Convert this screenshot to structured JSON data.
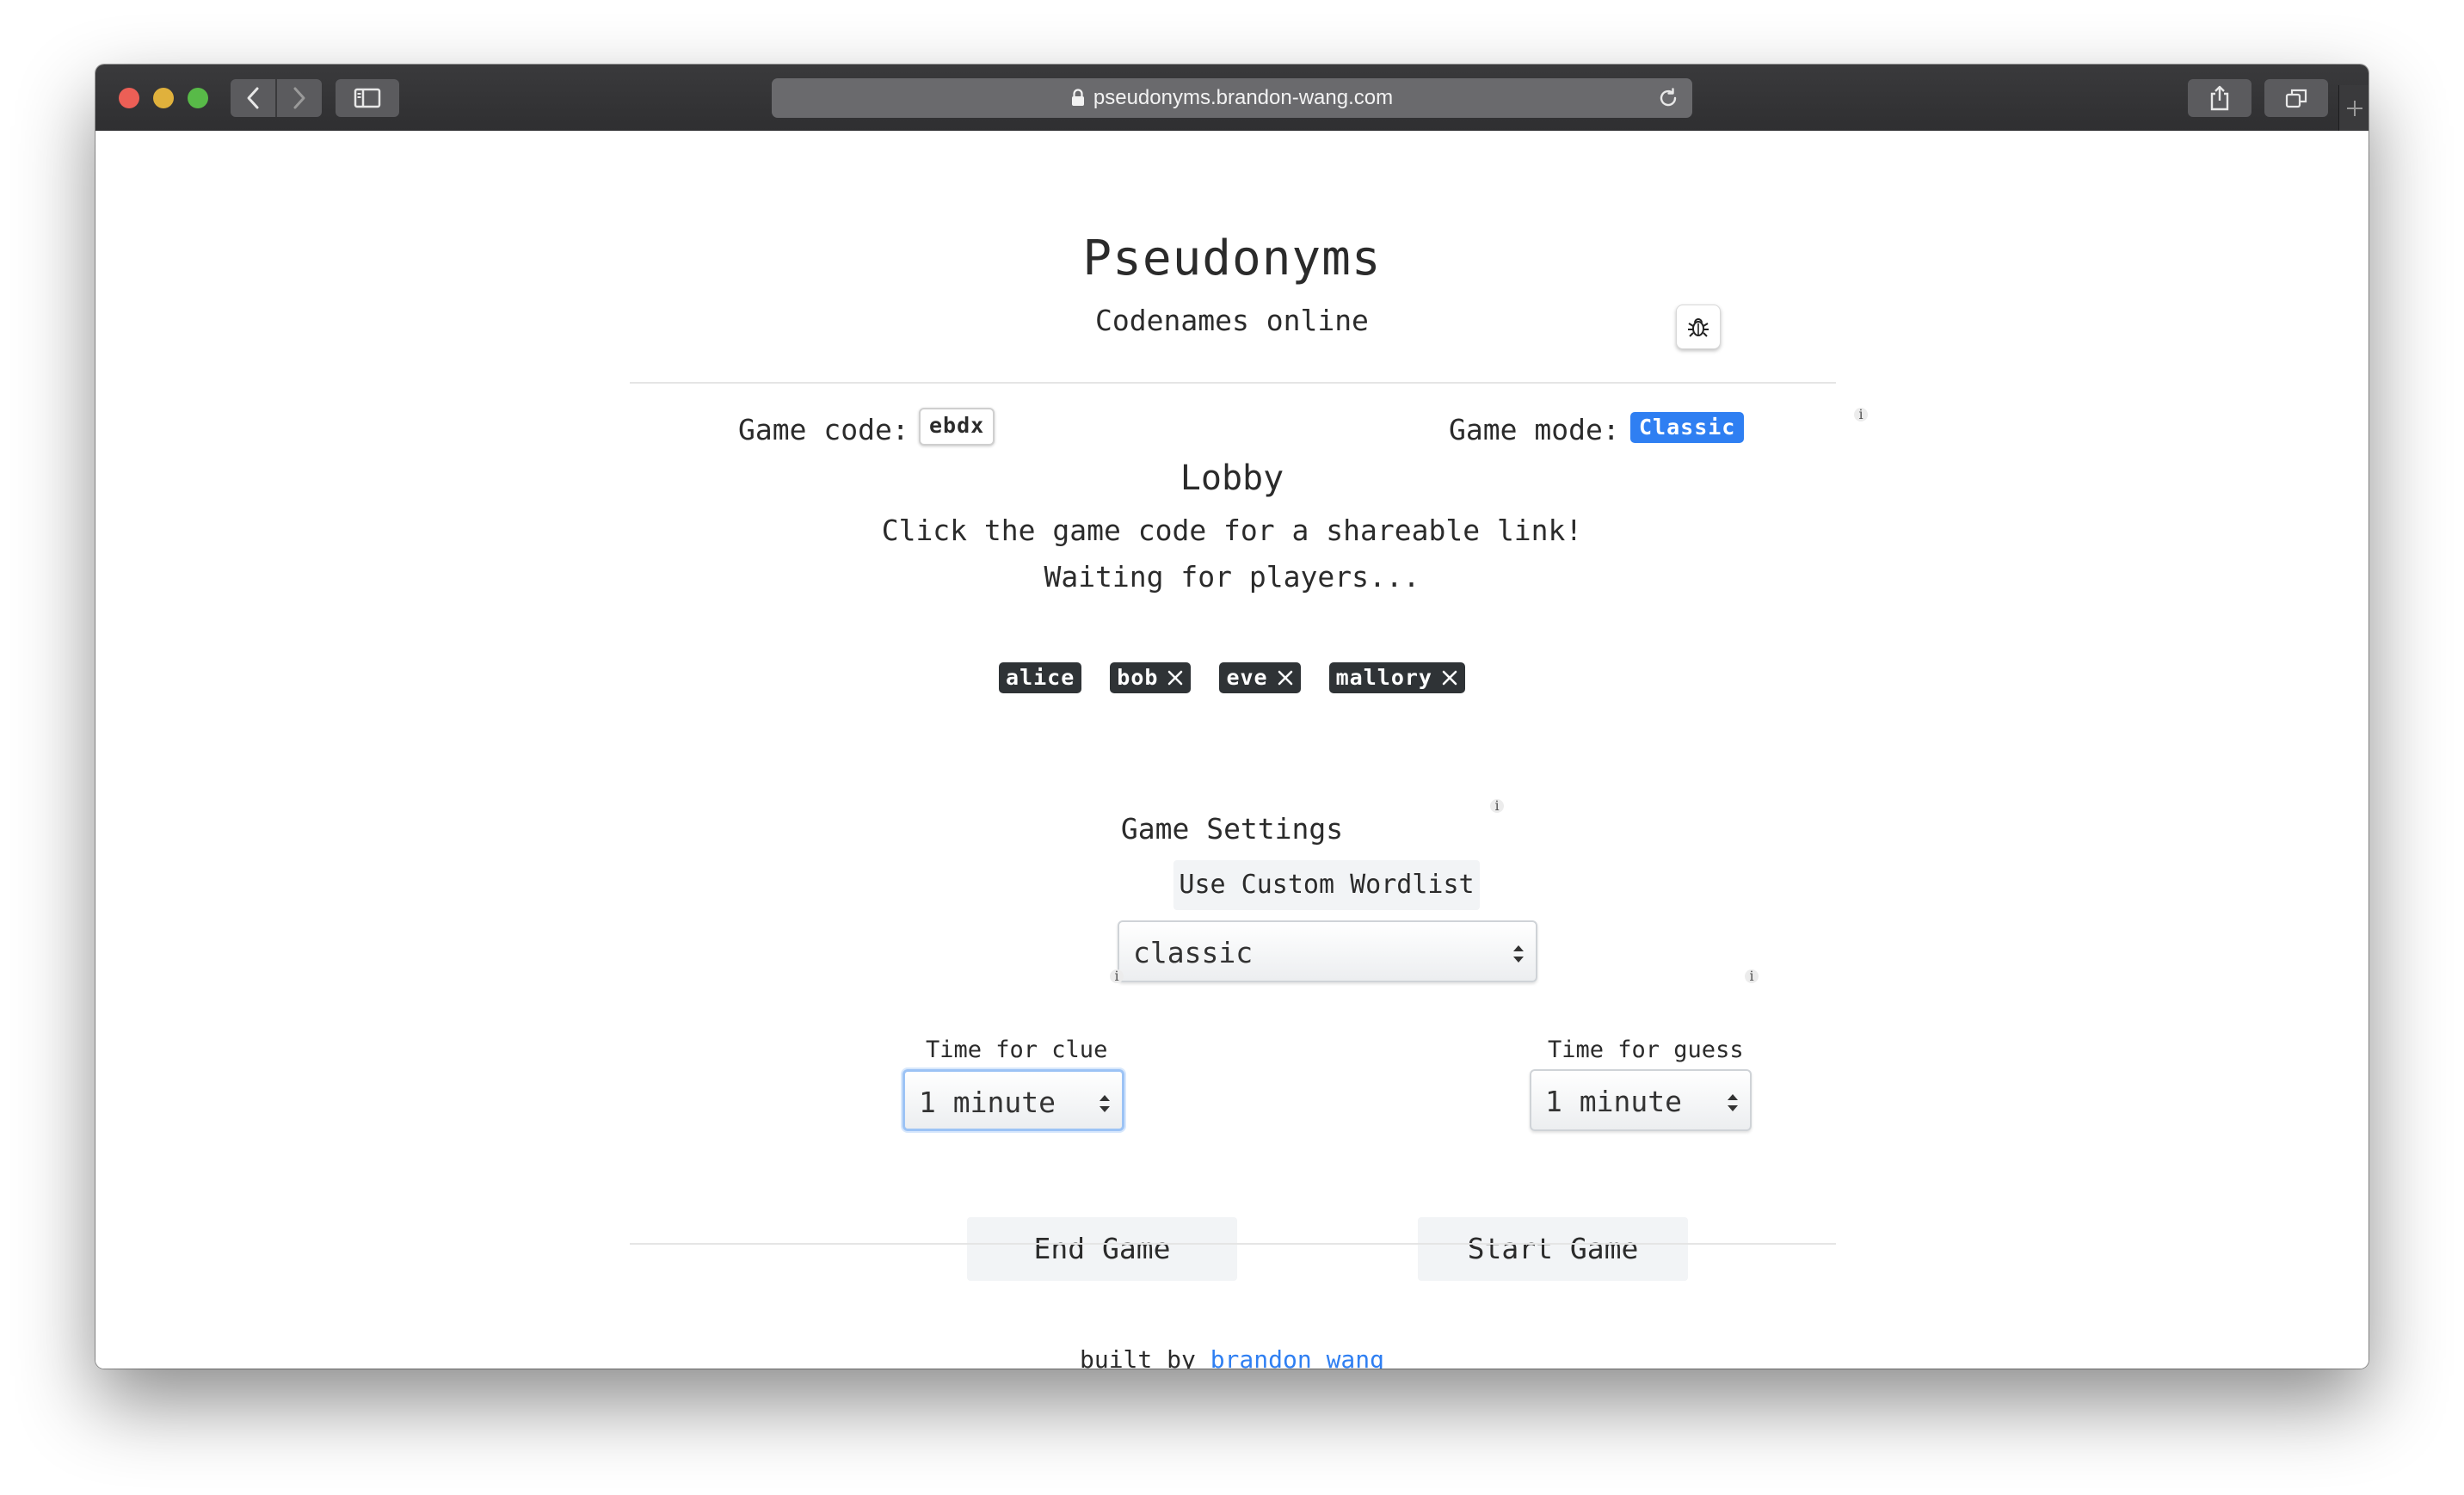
{
  "browser": {
    "url": "pseudonyms.brandon-wang.com"
  },
  "header": {
    "title": "Pseudonyms",
    "subtitle": "Codenames online"
  },
  "game": {
    "code_label": "Game code:",
    "code": "ebdx",
    "mode_label": "Game mode:",
    "mode": "Classic",
    "info_glyph": "i",
    "status": "Lobby",
    "hint": "Click the game code for a shareable link!",
    "waiting": "Waiting for players..."
  },
  "players": [
    {
      "name": "alice",
      "removable": false
    },
    {
      "name": "bob",
      "removable": true
    },
    {
      "name": "eve",
      "removable": true
    },
    {
      "name": "mallory",
      "removable": true
    }
  ],
  "settings": {
    "title": "Game Settings",
    "custom_wordlist_label": "Use Custom Wordlist",
    "wordlist_value": "classic",
    "clue_label": "Time for clue",
    "clue_value": "1 minute",
    "guess_label": "Time for guess",
    "guess_value": "1 minute"
  },
  "actions": {
    "end_label": "End Game",
    "start_label": "Start Game"
  },
  "footer": {
    "prefix": "built by",
    "author": "brandon wang"
  },
  "colors": {
    "accent": "#2f7ff2",
    "player_chip": "#2f3336",
    "button_bg": "#f2f4f6"
  }
}
